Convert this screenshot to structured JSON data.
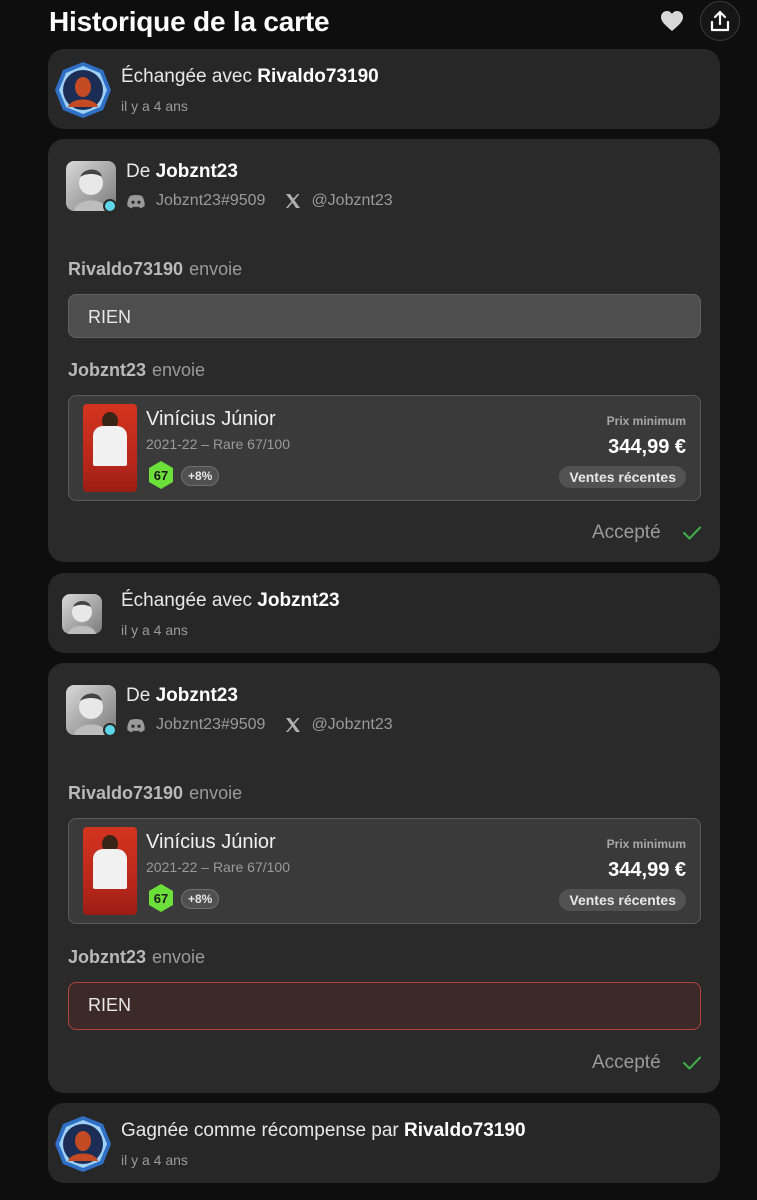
{
  "header": {
    "title": "Historique de la carte",
    "heart_icon": "heart-icon",
    "share_icon": "share-icon"
  },
  "events": [
    {
      "prefix": "Échangée avec",
      "user": "Rivaldo73190",
      "time": "il y a 4 ans"
    },
    {
      "prefix": "Échangée avec",
      "user": "Jobznt23",
      "time": "il y a 4 ans"
    },
    {
      "prefix": "Gagnée comme récompense par",
      "user": "Rivaldo73190",
      "time": "il y a 4 ans"
    }
  ],
  "offers": [
    {
      "from_label": "De",
      "from_user": "Jobznt23",
      "discord": "Jobznt23#9509",
      "twitter": "@Jobznt23",
      "sender1": "Rivaldo73190",
      "sender2": "Jobznt23",
      "sends_label": "envoie",
      "rien": "RIEN",
      "status": "Accepté"
    },
    {
      "from_label": "De",
      "from_user": "Jobznt23",
      "discord": "Jobznt23#9509",
      "twitter": "@Jobznt23",
      "sender1": "Rivaldo73190",
      "sender2": "Jobznt23",
      "sends_label": "envoie",
      "rien": "RIEN",
      "status": "Accepté"
    }
  ],
  "card_item": {
    "player": "Vinícius Júnior",
    "meta": "2021-22 – Rare 67/100",
    "score": "67",
    "bonus": "+8%",
    "price_label": "Prix minimum",
    "price": "344,99 €",
    "recent_label": "Ventes récentes"
  },
  "colors": {
    "online": "#5ed6e8",
    "score_green": "#6ddf3a",
    "accept_check": "#3fae4a",
    "rien_red_border": "#b0433a"
  }
}
